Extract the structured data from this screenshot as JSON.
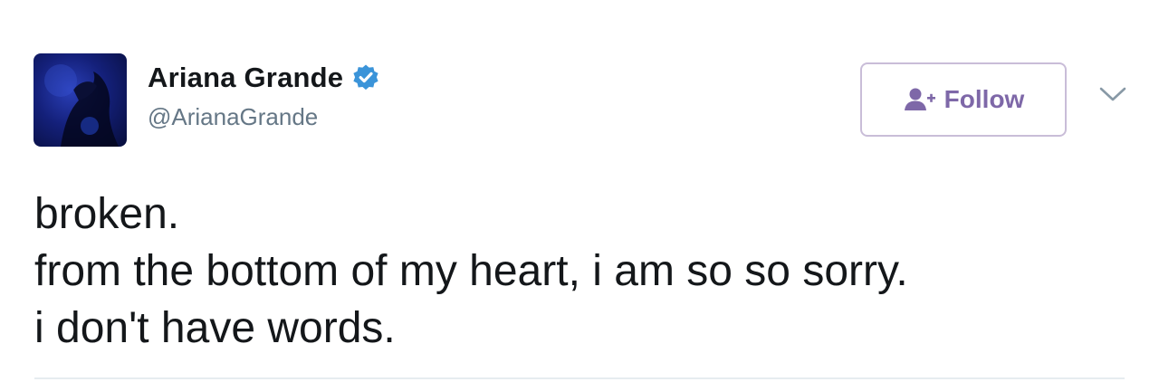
{
  "author": {
    "display_name": "Ariana Grande",
    "handle": "@ArianaGrande",
    "verified": true,
    "avatar_icon": "profile-photo"
  },
  "actions": {
    "follow_label": "Follow",
    "follow_icon": "add-user-icon",
    "more_icon": "chevron-down-icon"
  },
  "tweet": {
    "lines": [
      "broken.",
      "from the bottom of my heart, i am so so sorry.",
      "i don't have words."
    ]
  },
  "colors": {
    "verified_badge": "#3b94d9",
    "follow_text": "#7e68a8",
    "follow_border": "#c9bdd8",
    "handle": "#657786",
    "text": "#14171a"
  }
}
